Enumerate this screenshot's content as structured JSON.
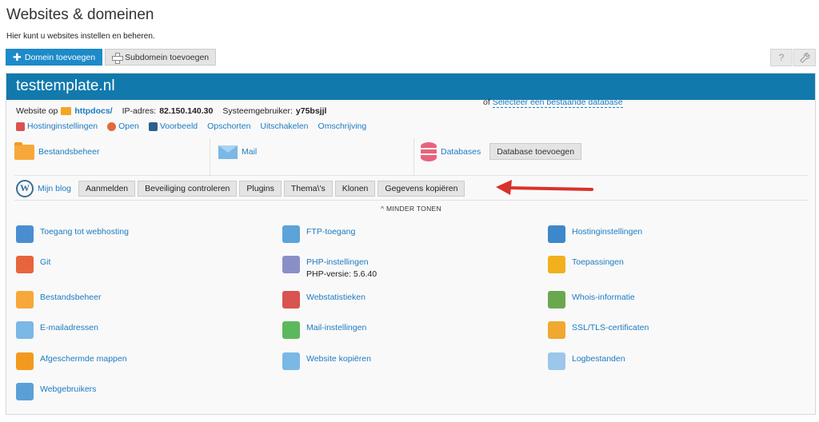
{
  "page": {
    "title": "Websites & domeinen",
    "subtitle": "Hier kunt u websites instellen en beheren."
  },
  "toolbar": {
    "add_domain": "Domein toevoegen",
    "add_subdomain": "Subdomein toevoegen",
    "help_icon": "?",
    "tools_icon": "wrench-icon"
  },
  "domain": {
    "name": "testtemplate.nl",
    "website_label": "Website op",
    "docroot": "httpdocs/",
    "ip_label": "IP-adres:",
    "ip": "82.150.140.30",
    "user_label": "Systeemgebruiker:",
    "user": "y75bsjjl"
  },
  "actions": [
    {
      "label": "Hostinginstellingen",
      "icon": "hosting-settings-icon",
      "color": "#d9534f"
    },
    {
      "label": "Open",
      "icon": "open-icon",
      "color": "#e26b3c"
    },
    {
      "label": "Voorbeeld",
      "icon": "preview-icon",
      "color": "#2c5e8e"
    },
    {
      "label": "Opschorten"
    },
    {
      "label": "Uitschakelen"
    },
    {
      "label": "Omschrijving"
    }
  ],
  "tiles": {
    "files": "Bestandsbeheer",
    "mail": "Mail",
    "databases": "Databases",
    "db_add": "Database toevoegen",
    "db_or": "of",
    "db_select": "Selecteer een bestaande database"
  },
  "wordpress": {
    "blog": "Mijn blog",
    "buttons": [
      "Aanmelden",
      "Beveiliging controleren",
      "Plugins",
      "Thema\\'s",
      "Klonen",
      "Gegevens kopiëren"
    ]
  },
  "less_label": "^ MINDER TONEN",
  "grid": [
    [
      {
        "label": "Toegang tot webhosting",
        "icon": "webhosting-access-icon",
        "color": "#4a8ed1"
      },
      {
        "label": "FTP-toegang",
        "icon": "ftp-icon",
        "color": "#5ba3d9"
      },
      {
        "label": "Hostinginstellingen",
        "icon": "hosting-icon",
        "color": "#3d88c8"
      }
    ],
    [
      {
        "label": "Git",
        "icon": "git-icon",
        "color": "#e8643c"
      },
      {
        "label": "PHP-instellingen",
        "sub": "PHP-versie: 5.6.40",
        "icon": "php-icon",
        "color": "#8a8fc7"
      },
      {
        "label": "Toepassingen",
        "icon": "applications-icon",
        "color": "#f2b01e"
      }
    ],
    [
      {
        "label": "Bestandsbeheer",
        "icon": "file-manager-icon",
        "color": "#f7a83a"
      },
      {
        "label": "Webstatistieken",
        "icon": "web-stats-icon",
        "color": "#d9534f"
      },
      {
        "label": "Whois-informatie",
        "icon": "whois-icon",
        "color": "#6aa84f"
      }
    ],
    [
      {
        "label": "E-mailadressen",
        "icon": "email-icon",
        "color": "#7ab8e6"
      },
      {
        "label": "Mail-instellingen",
        "icon": "mail-settings-icon",
        "color": "#5cb85c"
      },
      {
        "label": "SSL/TLS-certificaten",
        "icon": "ssl-icon",
        "color": "#f0a830"
      }
    ],
    [
      {
        "label": "Afgeschermde mappen",
        "icon": "protected-folder-icon",
        "color": "#f29a1e"
      },
      {
        "label": "Website kopiëren",
        "icon": "copy-website-icon",
        "color": "#7ab8e6"
      },
      {
        "label": "Logbestanden",
        "icon": "logs-icon",
        "color": "#9cc6ea"
      }
    ],
    [
      {
        "label": "Webgebruikers",
        "icon": "web-users-icon",
        "color": "#5aa0d8"
      }
    ]
  ]
}
